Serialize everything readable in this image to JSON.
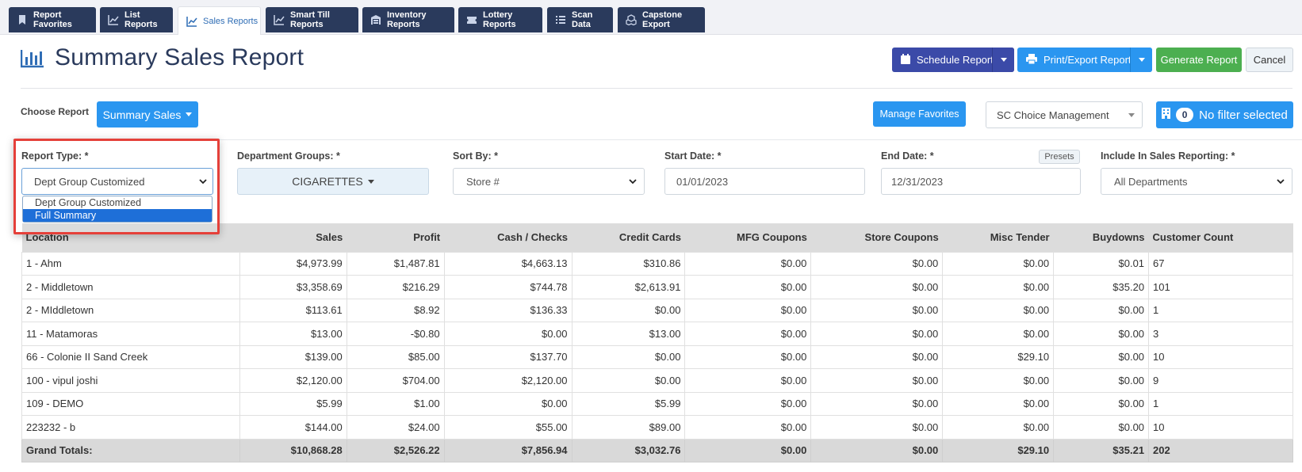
{
  "tabs": [
    {
      "label": "Report Favorites",
      "icon": "bookmark-icon"
    },
    {
      "label": "List Reports",
      "icon": "line-chart-icon"
    },
    {
      "label": "Sales Reports",
      "icon": "line-chart-icon",
      "active": true
    },
    {
      "label": "Smart Till Reports",
      "icon": "line-chart-icon"
    },
    {
      "label": "Inventory Reports",
      "icon": "warehouse-icon"
    },
    {
      "label": "Lottery Reports",
      "icon": "ticket-icon"
    },
    {
      "label": "Scan Data",
      "icon": "list-icon"
    },
    {
      "label": "Capstone Export",
      "icon": "cubes-icon"
    }
  ],
  "header": {
    "title": "Summary Sales Report",
    "schedule_label": "Schedule Report",
    "print_label": "Print/Export Report",
    "generate_label": "Generate Report",
    "cancel_label": "Cancel"
  },
  "toolbar": {
    "choose_label": "Choose Report",
    "summary_label": "Summary Sales",
    "manage_label": "Manage Favorites",
    "store_value": "SC Choice Management",
    "filter_count": "0",
    "filter_label": "No filter selected"
  },
  "filters": {
    "report_type_label": "Report Type: *",
    "report_type_value": "Dept Group Customized",
    "report_type_options": [
      "Dept Group Customized",
      "Full Summary"
    ],
    "dept_groups_label": "Department Groups: *",
    "dept_groups_value": "CIGARETTES",
    "sort_label": "Sort By: *",
    "sort_value": "Store #",
    "start_label": "Start Date: *",
    "start_value": "01/01/2023",
    "end_label": "End Date: *",
    "end_value": "12/31/2023",
    "presets_label": "Presets",
    "include_label": "Include In Sales Reporting: *",
    "include_value": "All Departments"
  },
  "table": {
    "columns": [
      "Location",
      "Sales",
      "Profit",
      "Cash / Checks",
      "Credit Cards",
      "MFG Coupons",
      "Store Coupons",
      "Misc Tender",
      "Buydowns",
      "Customer Count"
    ],
    "rows": [
      [
        "1 - Ahm",
        "$4,973.99",
        "$1,487.81",
        "$4,663.13",
        "$310.86",
        "$0.00",
        "$0.00",
        "$0.00",
        "$0.01",
        "67"
      ],
      [
        "2 - Middletown",
        "$3,358.69",
        "$216.29",
        "$744.78",
        "$2,613.91",
        "$0.00",
        "$0.00",
        "$0.00",
        "$35.20",
        "101"
      ],
      [
        "2 - MIddletown",
        "$113.61",
        "$8.92",
        "$136.33",
        "$0.00",
        "$0.00",
        "$0.00",
        "$0.00",
        "$0.00",
        "1"
      ],
      [
        "11 - Matamoras",
        "$13.00",
        "-$0.80",
        "$0.00",
        "$13.00",
        "$0.00",
        "$0.00",
        "$0.00",
        "$0.00",
        "3"
      ],
      [
        "66 - Colonie II Sand Creek",
        "$139.00",
        "$85.00",
        "$137.70",
        "$0.00",
        "$0.00",
        "$0.00",
        "$29.10",
        "$0.00",
        "10"
      ],
      [
        "100 - vipul joshi",
        "$2,120.00",
        "$704.00",
        "$2,120.00",
        "$0.00",
        "$0.00",
        "$0.00",
        "$0.00",
        "$0.00",
        "9"
      ],
      [
        "109 - DEMO",
        "$5.99",
        "$1.00",
        "$0.00",
        "$5.99",
        "$0.00",
        "$0.00",
        "$0.00",
        "$0.00",
        "1"
      ],
      [
        "223232 - b",
        "$144.00",
        "$24.00",
        "$55.00",
        "$89.00",
        "$0.00",
        "$0.00",
        "$0.00",
        "$0.00",
        "10"
      ]
    ],
    "totals": [
      "Grand Totals:",
      "$10,868.28",
      "$2,526.22",
      "$7,856.94",
      "$3,032.76",
      "$0.00",
      "$0.00",
      "$29.10",
      "$35.21",
      "202"
    ]
  },
  "colors": {
    "navy": "#2a3a5c",
    "blue": "#2a96f0",
    "indigo": "#3b4aa8",
    "green": "#4caf50",
    "highlight_red": "#e5403a"
  }
}
